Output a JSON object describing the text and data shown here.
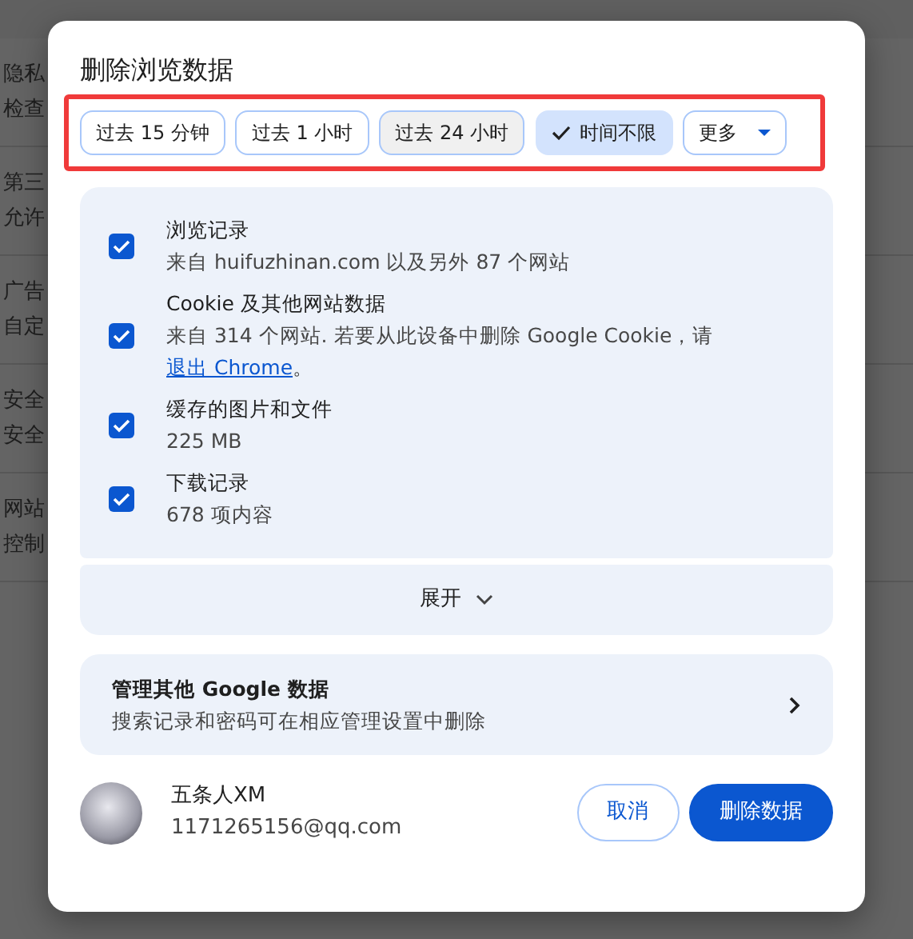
{
  "background_items": [
    {
      "title": "隐私",
      "subtitle": "检查"
    },
    {
      "title": "第三",
      "subtitle": "允许"
    },
    {
      "title": "广告",
      "subtitle": "自定"
    },
    {
      "title": "安全",
      "subtitle": "安全"
    },
    {
      "title": "网站",
      "subtitle": "控制"
    }
  ],
  "dialog": {
    "title": "删除浏览数据",
    "time_range": {
      "highlighted": true,
      "options": [
        {
          "label": "过去 15 分钟",
          "kind": "chip",
          "selected": false,
          "hovered": false
        },
        {
          "label": "过去 1 小时",
          "kind": "chip",
          "selected": false,
          "hovered": false
        },
        {
          "label": "过去 24 小时",
          "kind": "chip",
          "selected": false,
          "hovered": true
        },
        {
          "label": "时间不限",
          "kind": "chip",
          "selected": true,
          "hovered": false
        },
        {
          "label": "更多",
          "kind": "dropdown",
          "selected": false,
          "hovered": false
        }
      ]
    },
    "data_types": [
      {
        "title": "浏览记录",
        "subtitle": "来自 huifuzhinan.com 以及另外 87 个网站",
        "checked": true
      },
      {
        "title": "Cookie 及其他网站数据",
        "subtitle": "来自 314 个网站. 若要从此设备中删除 Google Cookie，请",
        "link": "退出 Chrome",
        "subtitle_end": "。",
        "checked": true
      },
      {
        "title": "缓存的图片和文件",
        "subtitle": "225 MB",
        "checked": true
      },
      {
        "title": "下载记录",
        "subtitle": "678 项内容",
        "checked": true
      }
    ],
    "expand": {
      "label": "展开"
    },
    "manage": {
      "title": "管理其他 Google 数据",
      "subtitle": "搜索记录和密码可在相应管理设置中删除"
    },
    "account": {
      "name": "五条人XM",
      "email": "1171265156@qq.com"
    },
    "buttons": [
      {
        "label": "取消",
        "kind": "secondary"
      },
      {
        "label": "删除数据",
        "kind": "primary"
      }
    ]
  }
}
